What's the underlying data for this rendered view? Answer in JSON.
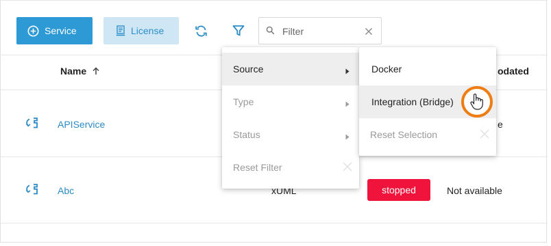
{
  "toolbar": {
    "service_label": "Service",
    "license_label": "License",
    "filter_placeholder": "Filter",
    "filter_value": ""
  },
  "table": {
    "columns": {
      "name": "Name",
      "updated": "odated"
    },
    "rows": [
      {
        "name": "APIService",
        "updated_partial": "e"
      },
      {
        "name": "Abc",
        "type_partial": "xUML",
        "status": "stopped",
        "updated": "Not available"
      }
    ]
  },
  "filter_menu": {
    "items": [
      {
        "label": "Source",
        "state": "active"
      },
      {
        "label": "Type",
        "state": "disabled"
      },
      {
        "label": "Status",
        "state": "disabled"
      },
      {
        "label": "Reset Filter",
        "state": "disabled"
      }
    ]
  },
  "source_submenu": {
    "items": [
      {
        "label": "Docker"
      },
      {
        "label": "Integration (Bridge)",
        "state": "hovered"
      },
      {
        "label": "Reset Selection",
        "state": "disabled"
      }
    ]
  },
  "colors": {
    "primary": "#2d9ad6",
    "secondary_bg": "#cfe6f4",
    "link": "#2a8bc7",
    "stopped_badge": "#f0133b",
    "cursor_highlight": "#ee7d12"
  },
  "icons": [
    "plus-circle-icon",
    "license-icon",
    "refresh-icon",
    "filter-icon",
    "search-icon",
    "clear-icon",
    "sort-up-icon",
    "sync-icon",
    "chevron-right-icon",
    "close-icon",
    "hand-cursor-icon"
  ]
}
